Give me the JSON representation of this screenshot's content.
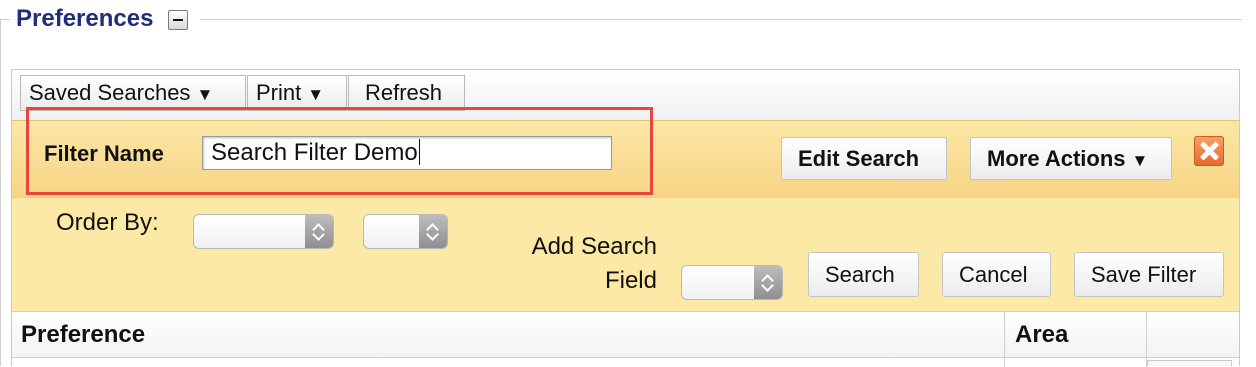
{
  "fieldset": {
    "legend": "Preferences",
    "collapse_icon": "minus-icon"
  },
  "toolbar": {
    "saved_searches": "Saved Searches",
    "print": "Print",
    "refresh": "Refresh",
    "dropdown_arrow": "▼"
  },
  "filter": {
    "label": "Filter Name",
    "value": "Search Filter Demo",
    "edit_search": "Edit Search",
    "more_actions": "More Actions",
    "more_actions_arrow": "▼",
    "close_icon": "close-x-icon",
    "highlight_color": "#e8453c"
  },
  "search": {
    "order_by_label": "Order By:",
    "add_field_line1": "Add Search",
    "add_field_line2": "Field",
    "search_button": "Search",
    "cancel_button": "Cancel",
    "save_filter_button": "Save Filter"
  },
  "table": {
    "columns": [
      "Preference",
      "Area"
    ]
  },
  "colors": {
    "legend": "#1f2d7a",
    "filter_band": "#f7d486",
    "search_band": "#fde9a6"
  }
}
